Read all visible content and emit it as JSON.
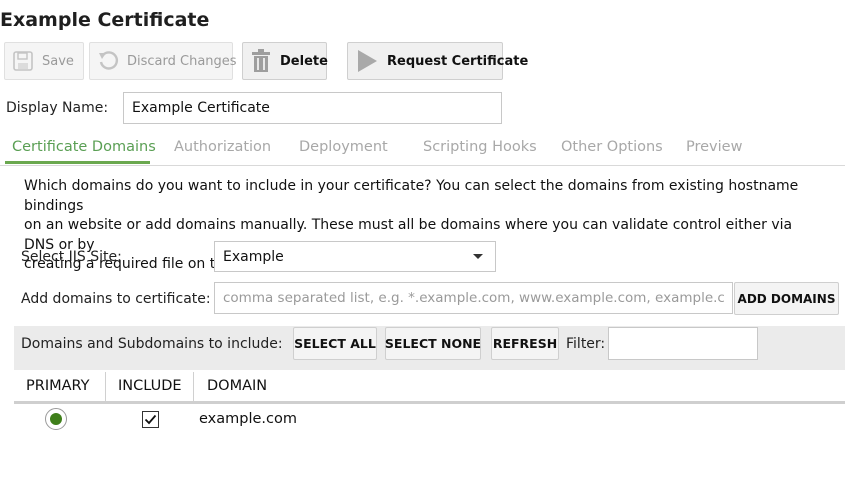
{
  "page": {
    "title": "Example Certificate"
  },
  "toolbar": {
    "save_label": "Save",
    "discard_label": "Discard Changes",
    "delete_label": "Delete",
    "request_label": "Request Certificate"
  },
  "display_name": {
    "label": "Display Name:",
    "value": "Example Certificate"
  },
  "tabs": [
    {
      "label": "Certificate Domains",
      "active": true
    },
    {
      "label": "Authorization",
      "active": false
    },
    {
      "label": "Deployment",
      "active": false
    },
    {
      "label": "Scripting Hooks",
      "active": false
    },
    {
      "label": "Other Options",
      "active": false
    },
    {
      "label": "Preview",
      "active": false
    }
  ],
  "domains_tab": {
    "description_lines": [
      "Which domains do you want to include in your certificate? You can select the domains from existing hostname bindings",
      "on an website or add domains manually. These must all be domains where you can validate control either via DNS or by",
      "creating a required file on the website (see the Authorization tab)."
    ],
    "iis_site_label": "Select IIS Site:",
    "iis_site_value": "Example",
    "add_domains_label": "Add domains to certificate:",
    "add_domains_placeholder": "comma separated list, e.g. *.example.com, www.example.com, example.com",
    "add_domains_button": "ADD DOMAINS",
    "include_label": "Domains and Subdomains to include:",
    "select_all": "SELECT ALL",
    "select_none": "SELECT NONE",
    "refresh": "REFRESH",
    "filter_label": "Filter:",
    "filter_value": ""
  },
  "table": {
    "columns": [
      "PRIMARY",
      "INCLUDE",
      "DOMAIN"
    ],
    "rows": [
      {
        "primary": true,
        "include": true,
        "domain": "example.com"
      }
    ]
  },
  "colors": {
    "accent_green": "#6aa84f",
    "radio_green": "#3f7f1a",
    "disabled_text": "#9a9a9a"
  }
}
